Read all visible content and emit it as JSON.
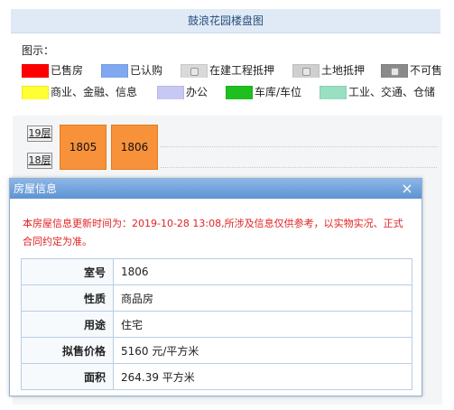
{
  "page": {
    "title": "鼓浪花园楼盘图"
  },
  "legend": {
    "label": "图示：",
    "items": [
      {
        "label": "已售房",
        "color": "#ff0000"
      },
      {
        "label": "已认购",
        "color": "#7fa8f0"
      },
      {
        "label": "在建工程抵押",
        "color": "#d9d9d9",
        "icon": "lock-icon"
      },
      {
        "label": "土地抵押",
        "color": "#cfcfcf",
        "icon": "lock-icon"
      },
      {
        "label": "不可售",
        "color": "#8a8a8a",
        "icon": "lock-icon"
      },
      {
        "label": "商业、金融、信息",
        "color": "#ffff33"
      },
      {
        "label": "办公",
        "color": "#c8c8f5"
      },
      {
        "label": "车库/车位",
        "color": "#1fbf1f"
      },
      {
        "label": "工业、交通、仓储",
        "color": "#99dfc2"
      }
    ]
  },
  "floors": [
    {
      "label": "19层"
    },
    {
      "label": "18层"
    }
  ],
  "units": [
    {
      "number": "1805",
      "color": "#f7923a"
    },
    {
      "number": "1806",
      "color": "#f7923a"
    }
  ],
  "dialog": {
    "title": "房屋信息",
    "close_icon": "×",
    "notice": "本房屋信息更新时间为：2019-10-28 13:08,所涉及信息仅供参考，以实物实况、正式合同约定为准。",
    "rows": [
      {
        "key": "室号",
        "value": "1806"
      },
      {
        "key": "性质",
        "value": "商品房"
      },
      {
        "key": "用途",
        "value": "住宅"
      },
      {
        "key": "拟售价格",
        "value": "5160 元/平方米"
      },
      {
        "key": "面积",
        "value": "264.39 平方米"
      }
    ]
  }
}
